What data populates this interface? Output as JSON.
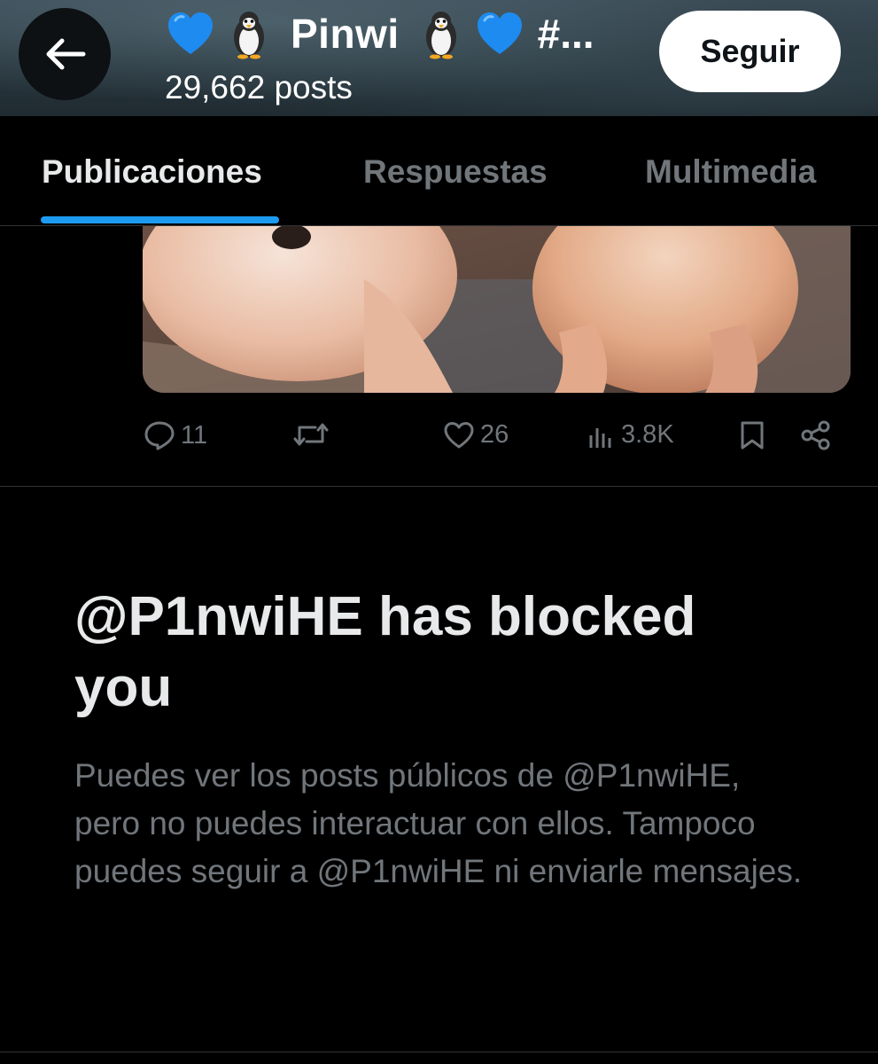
{
  "header": {
    "title": "Pinwi",
    "title_tail": "#...",
    "posts_count": "29,662 posts",
    "follow_label": "Seguir",
    "icons": [
      "blue-heart-icon",
      "penguin-icon",
      "penguin-icon",
      "blue-heart-icon"
    ]
  },
  "tabs": [
    {
      "label": "Publicaciones",
      "active": true
    },
    {
      "label": "Respuestas",
      "active": false
    },
    {
      "label": "Multimedia",
      "active": false
    }
  ],
  "post": {
    "replies": "11",
    "reposts": "",
    "likes": "26",
    "views": "3.8K"
  },
  "blocked": {
    "title": "@P1nwiHE has blocked you",
    "description": "Puedes ver los posts públicos de @P1nwiHE, pero no puedes interactuar con ellos. Tampoco puedes seguir a @P1nwiHE ni enviarle mensajes."
  },
  "colors": {
    "accent": "#1d9bf0",
    "background": "#000000",
    "muted_text": "#71767b",
    "primary_text": "#e7e9ea"
  }
}
